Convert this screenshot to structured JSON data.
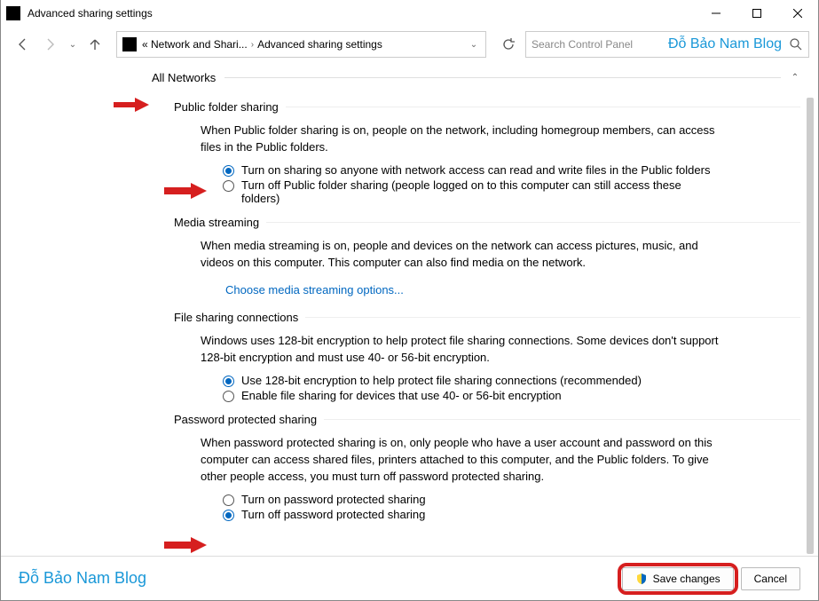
{
  "window": {
    "title": "Advanced sharing settings"
  },
  "breadcrumb": {
    "part1": "« Network and Shari...",
    "part2": "Advanced sharing settings"
  },
  "search": {
    "placeholder": "Search Control Panel",
    "watermark": "Đỗ Bảo Nam Blog"
  },
  "section": {
    "title": "All Networks"
  },
  "public_folder": {
    "heading": "Public folder sharing",
    "desc": "When Public folder sharing is on, people on the network, including homegroup members, can access files in the Public folders.",
    "opt_on": "Turn on sharing so anyone with network access can read and write files in the Public folders",
    "opt_off": "Turn off Public folder sharing (people logged on to this computer can still access these folders)"
  },
  "media": {
    "heading": "Media streaming",
    "desc": "When media streaming is on, people and devices on the network can access pictures, music, and videos on this computer. This computer can also find media on the network.",
    "link": "Choose media streaming options..."
  },
  "file_sharing": {
    "heading": "File sharing connections",
    "desc": "Windows uses 128-bit encryption to help protect file sharing connections. Some devices don't support 128-bit encryption and must use 40- or 56-bit encryption.",
    "opt_128": "Use 128-bit encryption to help protect file sharing connections (recommended)",
    "opt_40": "Enable file sharing for devices that use 40- or 56-bit encryption"
  },
  "password": {
    "heading": "Password protected sharing",
    "desc": "When password protected sharing is on, only people who have a user account and password on this computer can access shared files, printers attached to this computer, and the Public folders. To give other people access, you must turn off password protected sharing.",
    "opt_on": "Turn on password protected sharing",
    "opt_off": "Turn off password protected sharing"
  },
  "footer": {
    "watermark": "Đỗ Bảo Nam Blog",
    "save": "Save changes",
    "cancel": "Cancel"
  }
}
